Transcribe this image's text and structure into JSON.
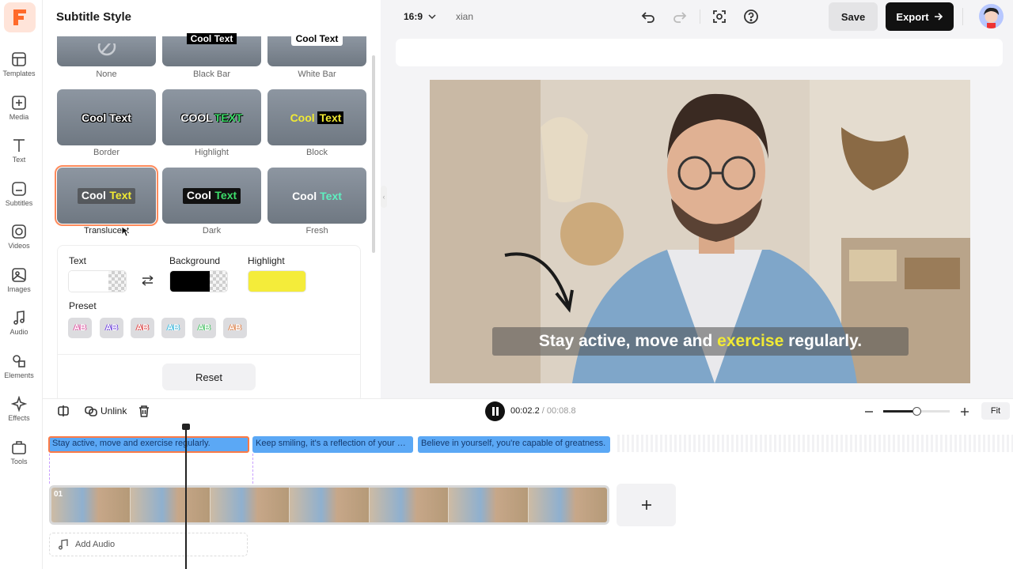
{
  "panel": {
    "title": "Subtitle Style",
    "top_labels": [
      "None",
      "Black Bar",
      "White Bar"
    ],
    "styles": [
      {
        "label": "Border",
        "text": "Cool Text"
      },
      {
        "label": "Highlight",
        "text_a": "COOL",
        "text_b": "TEXT"
      },
      {
        "label": "Block",
        "text_a": "Cool",
        "text_b": "Text"
      },
      {
        "label": "Translucent",
        "text_a": "Cool",
        "text_b": "Text"
      },
      {
        "label": "Dark",
        "text_a": "Cool",
        "text_b": "Text"
      },
      {
        "label": "Fresh",
        "text_a": "Cool",
        "text_b": "Text"
      }
    ],
    "top_tile_texts": [
      "Cool Text",
      "Cool Text"
    ],
    "text_label": "Text",
    "background_label": "Background",
    "highlight_label": "Highlight",
    "highlight_color": "#f4ec3a",
    "preset_label": "Preset",
    "preset_glyph": "AB",
    "reset_label": "Reset"
  },
  "rail": {
    "items": [
      "Templates",
      "Media",
      "Text",
      "Subtitles",
      "Videos",
      "Images",
      "Audio",
      "Elements",
      "Effects",
      "Tools"
    ]
  },
  "topbar": {
    "aspect": "16:9",
    "project_name": "xian",
    "save_label": "Save",
    "export_label": "Export"
  },
  "preview": {
    "caption_before": "Stay active, move and ",
    "caption_highlight": "exercise",
    "caption_after": " regularly."
  },
  "timeline": {
    "unlink_label": "Unlink",
    "current_time": "00:02.2",
    "duration": "/ 00:08.8",
    "fit_label": "Fit",
    "zoom_level": 0.5,
    "subtitles": [
      "Stay active, move and exercise regularly.",
      "Keep smiling, it's a reflection of your strength.",
      "Believe in yourself, you're capable of greatness."
    ],
    "track_number": "01",
    "add_audio_label": "Add Audio"
  },
  "colors": {
    "accent": "#ff7a45",
    "subtitle_clip": "#5ba8f5",
    "highlight_yellow": "#f1ea34"
  }
}
